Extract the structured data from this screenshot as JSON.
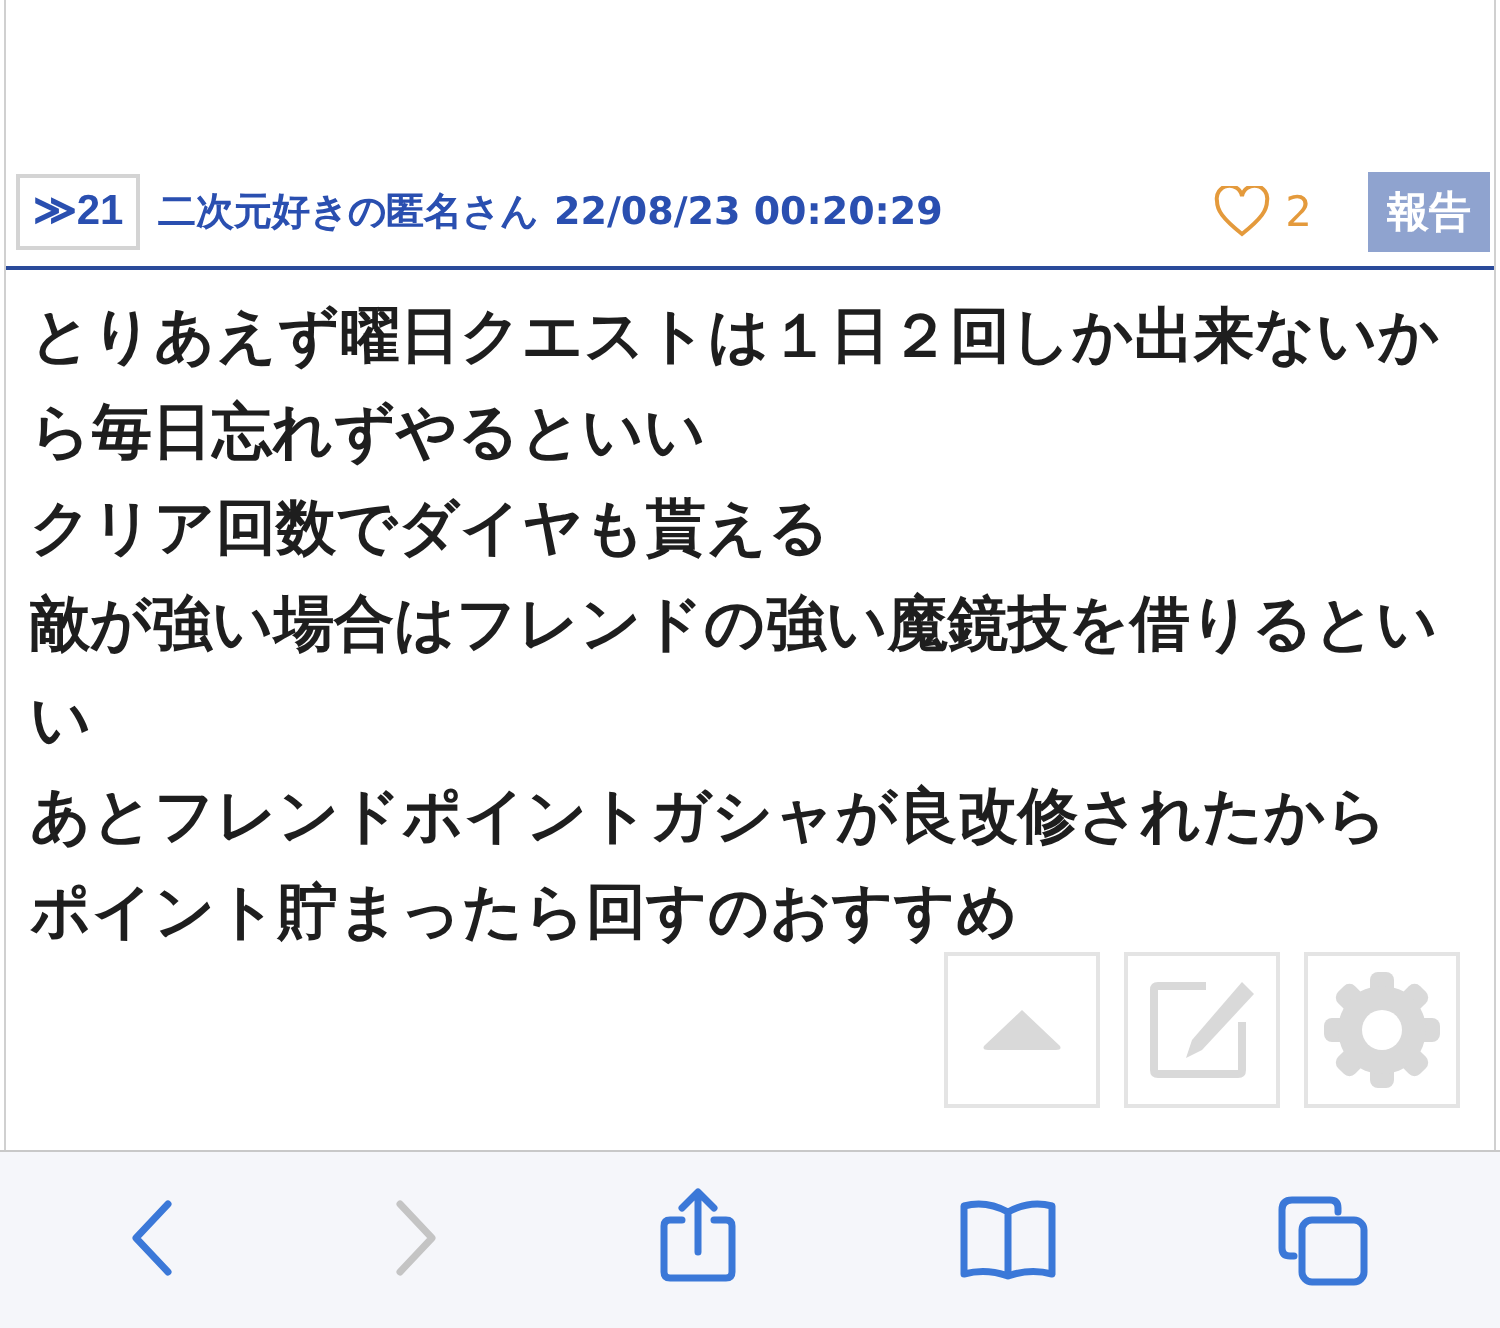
{
  "post": {
    "anchor": "≫21",
    "author": "二次元好きの匿名さん",
    "timestamp": "22/08/23 00:20:29",
    "likes": "2",
    "report_button": "報告",
    "lines": [
      "とりあえず曜日クエストは１日２回しか出来ないから毎日忘れずやるといい",
      "クリア回数でダイヤも貰える",
      "敵が強い場合はフレンドの強い魔鏡技を借りるといい",
      "あとフレンドポイントガシャが良改修されたから",
      "ポイント貯まったら回すのおすすめ"
    ]
  },
  "floating_buttons": [
    {
      "kind": "up"
    },
    {
      "kind": "edit"
    },
    {
      "kind": "settings"
    }
  ],
  "toolbar": [
    {
      "kind": "back",
      "disabled": false
    },
    {
      "kind": "forward",
      "disabled": true
    },
    {
      "kind": "share",
      "disabled": false
    },
    {
      "kind": "bookmarks",
      "disabled": false
    },
    {
      "kind": "tabs",
      "disabled": false
    }
  ]
}
